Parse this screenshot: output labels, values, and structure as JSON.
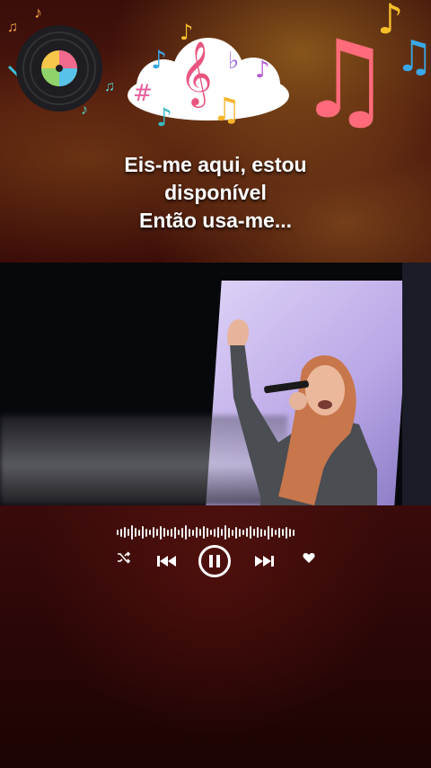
{
  "lyrics": {
    "line1": "Eis-me aqui, estou",
    "line2": "disponível",
    "line3": "Então usa-me..."
  },
  "player": {
    "shuffle_icon": "shuffle-icon",
    "prev_icon": "skip-previous-icon",
    "pause_icon": "pause-icon",
    "next_icon": "skip-next-icon",
    "like_icon": "heart-icon"
  },
  "colors": {
    "note_pink": "#ff6b7a",
    "note_blue": "#3aa7e6",
    "note_yellow": "#f5c02b"
  }
}
